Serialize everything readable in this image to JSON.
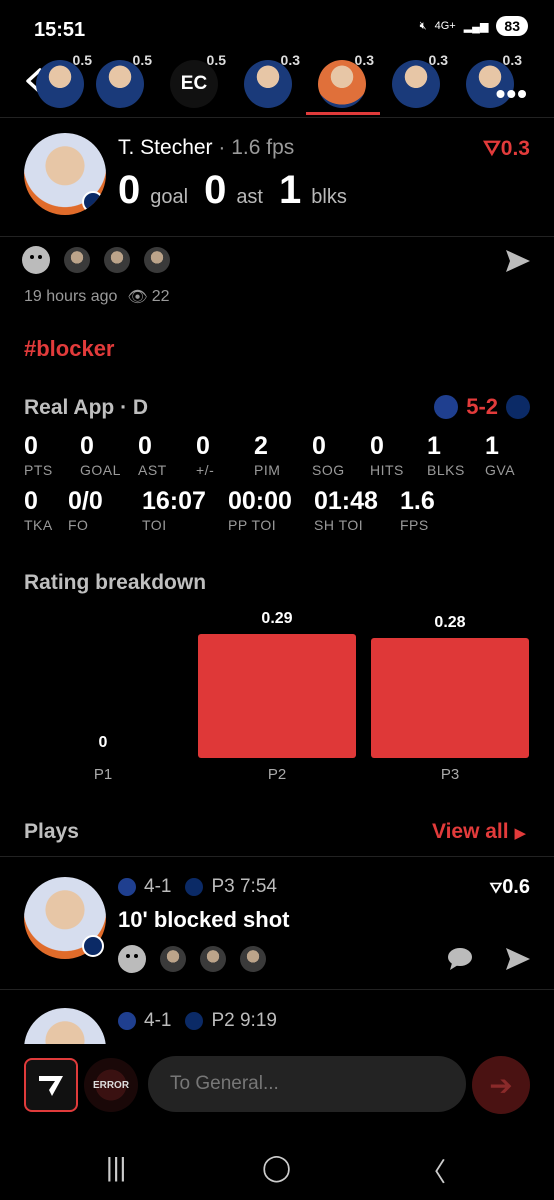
{
  "status": {
    "time": "15:51",
    "network": "4G+",
    "battery": "83"
  },
  "strip": {
    "players": [
      {
        "val": "0.5"
      },
      {
        "val": "0.5"
      },
      {
        "val": "0.5",
        "initials": "EC"
      },
      {
        "val": "0.3"
      },
      {
        "val": "0.3"
      },
      {
        "val": "0.3"
      },
      {
        "val": "0.3"
      }
    ]
  },
  "player": {
    "name": "T. Stecher",
    "fps": "· 1.6 fps",
    "goal": "0",
    "goal_label": "goal",
    "ast": "0",
    "ast_label": "ast",
    "blks": "1",
    "blks_label": "blks",
    "rating": "0.3"
  },
  "post": {
    "time_ago": "19 hours ago",
    "views": "22",
    "hashtag": "#blocker"
  },
  "game": {
    "title": "Real App · D",
    "score": "5-2",
    "row1": [
      {
        "v": "0",
        "l": "PTS"
      },
      {
        "v": "0",
        "l": "GOAL"
      },
      {
        "v": "0",
        "l": "AST"
      },
      {
        "v": "0",
        "l": "+/-"
      },
      {
        "v": "2",
        "l": "PIM"
      },
      {
        "v": "0",
        "l": "SOG"
      },
      {
        "v": "0",
        "l": "HITS"
      },
      {
        "v": "1",
        "l": "BLKS"
      },
      {
        "v": "1",
        "l": "GVA"
      }
    ],
    "row2": [
      {
        "v": "0",
        "l": "TKA"
      },
      {
        "v": "0/0",
        "l": "FO"
      },
      {
        "v": "16:07",
        "l": "TOI"
      },
      {
        "v": "00:00",
        "l": "PP TOI"
      },
      {
        "v": "01:48",
        "l": "SH TOI"
      },
      {
        "v": "1.6",
        "l": "FPS"
      }
    ]
  },
  "rating_breakdown": {
    "title": "Rating breakdown",
    "chart_data": {
      "type": "bar",
      "categories": [
        "P1",
        "P2",
        "P3"
      ],
      "values": [
        0,
        0.29,
        0.28
      ],
      "ylim": [
        0,
        0.29
      ],
      "color": "#df3838"
    }
  },
  "plays": {
    "title": "Plays",
    "view_all": "View all",
    "items": [
      {
        "score": "4-1",
        "period": "P3 7:54",
        "title": "10' blocked shot",
        "rating": "0.6"
      },
      {
        "score": "4-1",
        "period": "P2 9:19"
      }
    ]
  },
  "composer": {
    "placeholder": "To General...",
    "channel_badge": "ERROR"
  },
  "colors": {
    "accent": "#e23b3b",
    "background": "#000000"
  }
}
